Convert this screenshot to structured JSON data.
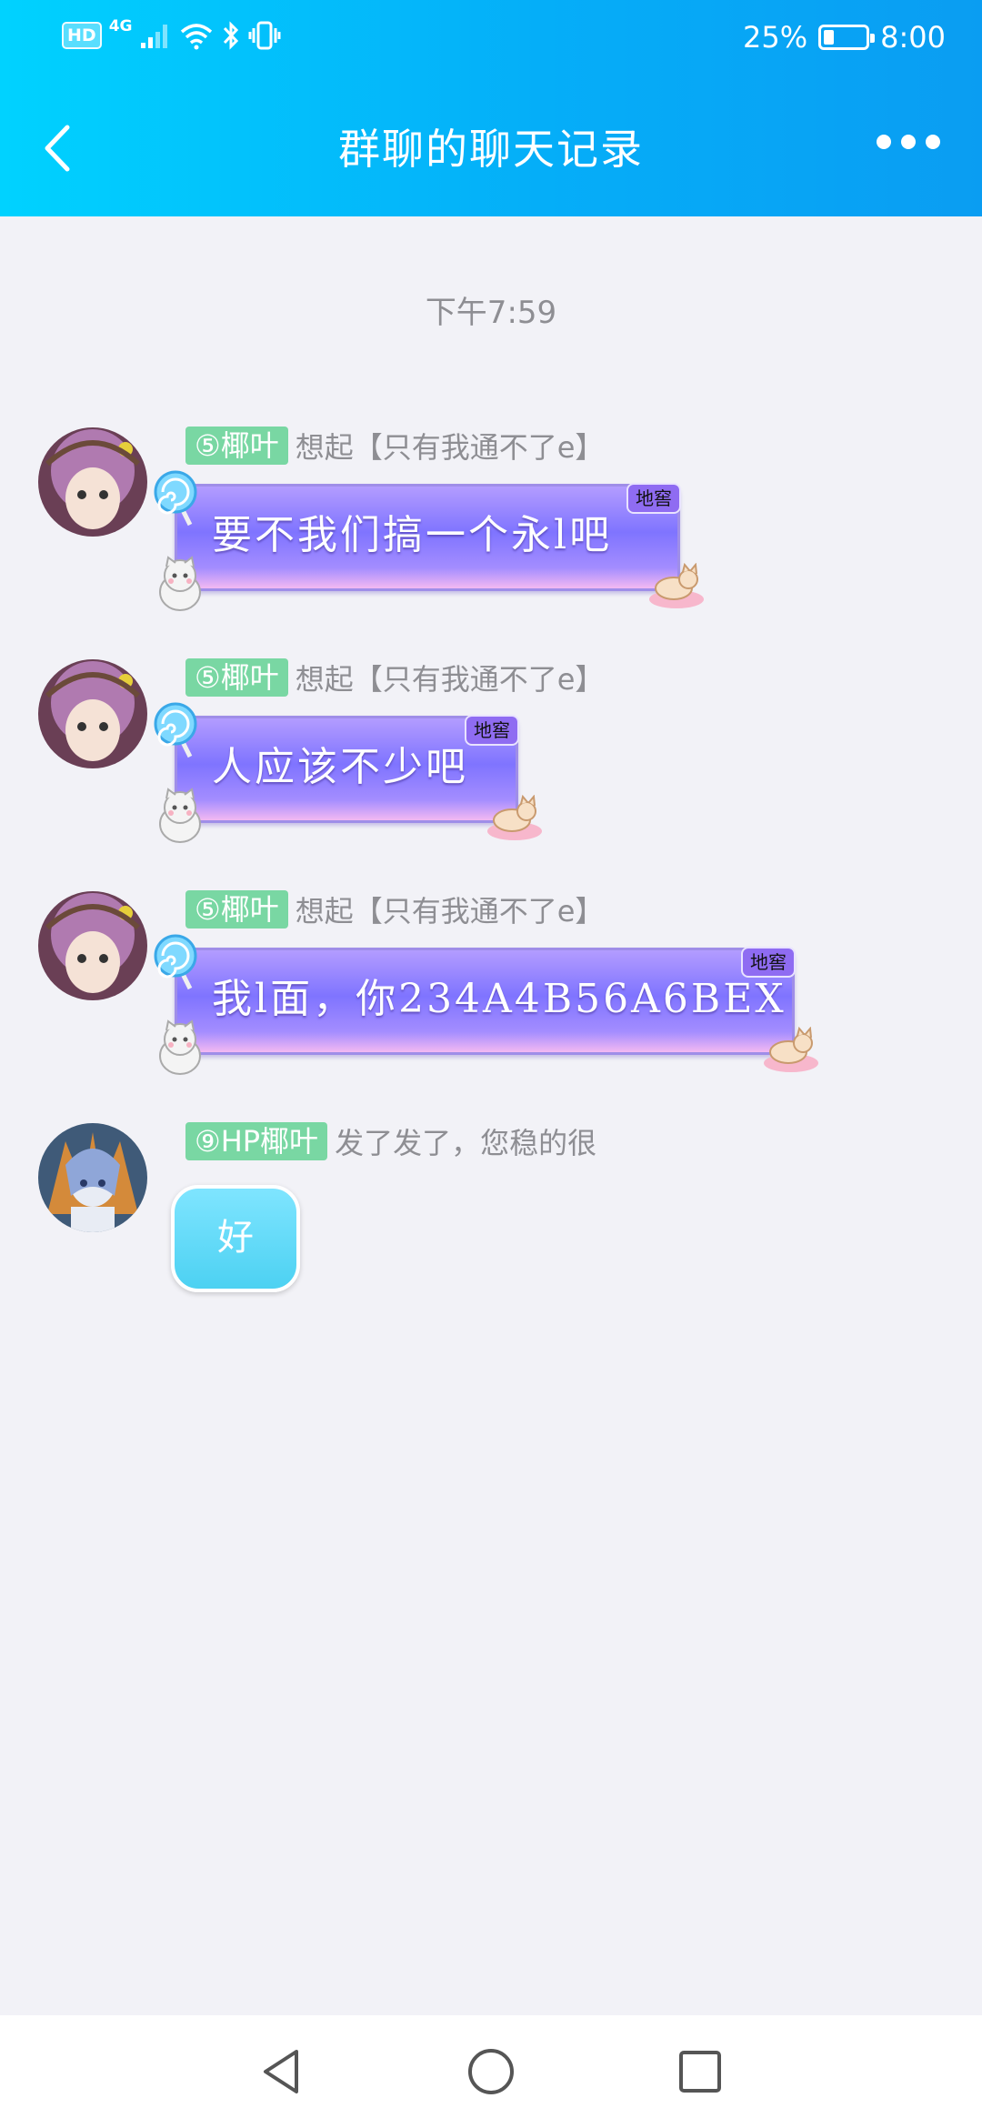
{
  "status_bar": {
    "hd": "HD",
    "network": "4G",
    "battery_text": "25%",
    "battery_level": 0.25,
    "time": "8:00"
  },
  "header": {
    "title": "群聊的聊天记录"
  },
  "timestamp": "下午7:59",
  "messages": [
    {
      "level": "⑤椰叶",
      "group_title": "想起【只有我通不了e】",
      "text": "要不我们搞一个永l吧",
      "tag": "地窖"
    },
    {
      "level": "⑤椰叶",
      "group_title": "想起【只有我通不了e】",
      "text": "人应该不少吧",
      "tag": "地窖"
    },
    {
      "level": "⑤椰叶",
      "group_title": "想起【只有我通不了e】",
      "text": "我l面，你234A4B56A6BEX",
      "tag": "地窖"
    },
    {
      "level": "⑨HP椰叶",
      "group_title": "发了发了，您稳的很",
      "text": "好"
    }
  ],
  "colors": {
    "header_start": "#00d2ff",
    "header_end": "#0a9df2",
    "level_tag": "#79d7a3",
    "bubble_purple": "#7f74ff",
    "bubble_cyan": "#4cd1f2",
    "background": "#f2f2f7"
  }
}
